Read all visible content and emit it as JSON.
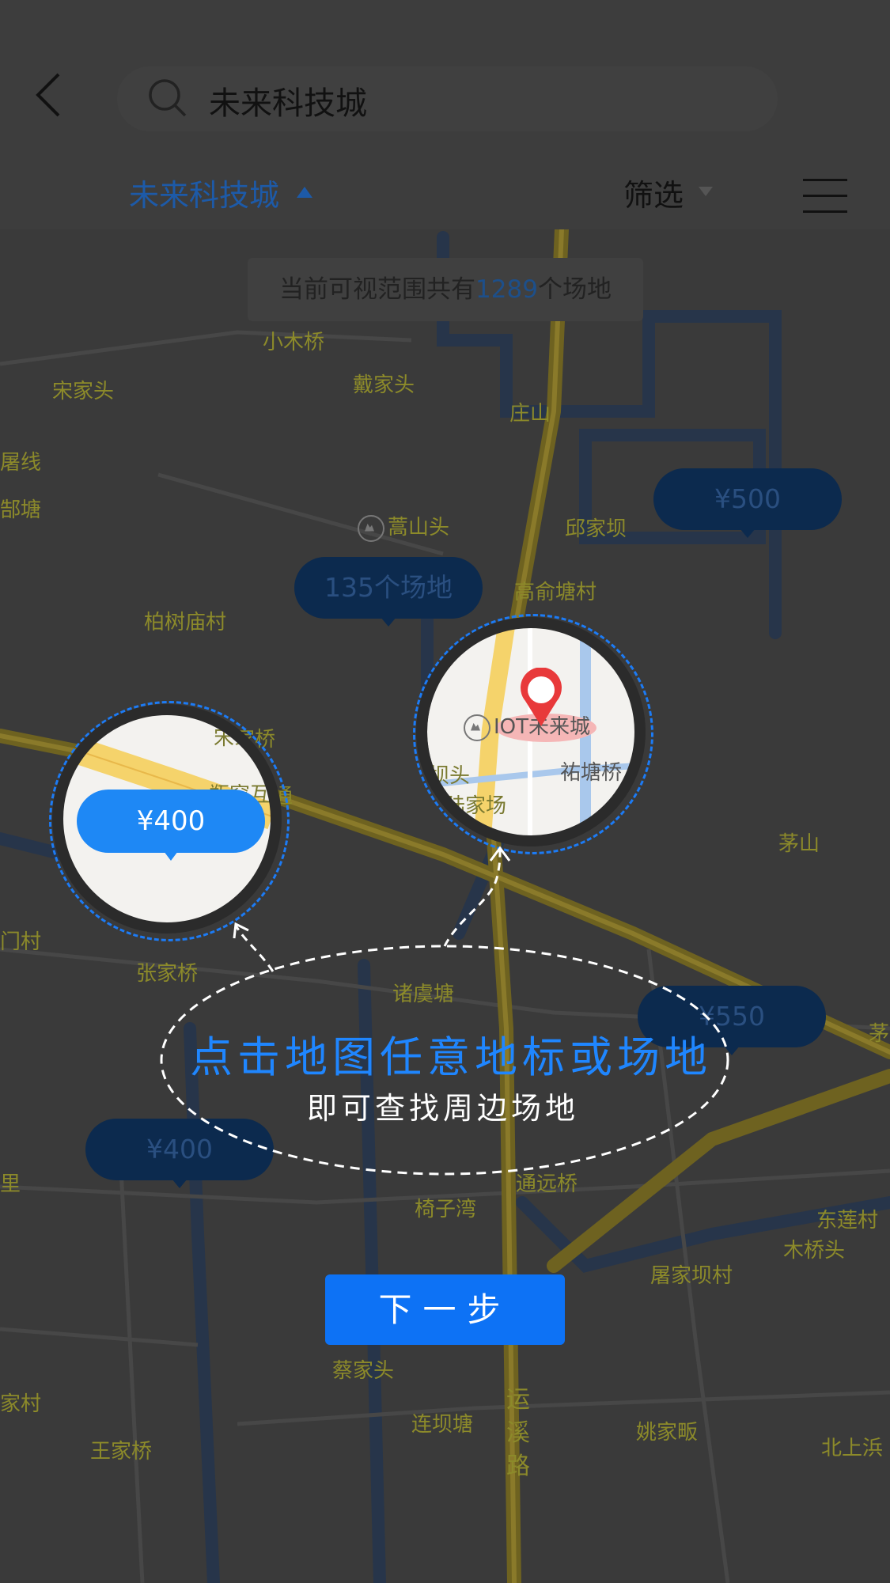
{
  "header": {
    "search_value": "未来科技城",
    "city_tab": "未来科技城",
    "filter_tab": "筛选"
  },
  "banner": {
    "prefix": "当前可视范围共有",
    "count": "1289",
    "suffix": "个场地"
  },
  "map_labels": [
    "小木桥",
    "宋家头",
    "戴家头",
    "庄山",
    "屠线",
    "郜塘",
    "蒿山头",
    "邱家坝",
    "高俞塘村",
    "柏树庙村",
    "吴家桥",
    "孙坝头",
    "陆家场",
    "茅山",
    "门村",
    "张家桥",
    "诸虞塘",
    "茅",
    "里",
    "椅子湾",
    "通远桥",
    "东莲村",
    "木桥头",
    "屠家坝村",
    "蔡家头",
    "连坝塘",
    "运",
    "溪",
    "路",
    "姚家畈",
    "北上浜",
    "家村",
    "王家桥",
    "瓶窑互通",
    "宋家桥",
    "里"
  ],
  "price_tags": {
    "tag_500": "¥500",
    "tag_venues": "135个场地",
    "tag_550": "¥550",
    "tag_400_bottom": "¥400"
  },
  "lens_left": {
    "price": "¥400",
    "labels": [
      "宋家桥",
      "瓶窑互通"
    ]
  },
  "lens_right": {
    "poi": "IOT未来城",
    "labels": [
      "孙坝头",
      "陆家场",
      "祐塘桥"
    ]
  },
  "hint": {
    "title": "点击地图任意地标或场地",
    "subtitle": "即可查找周边场地"
  },
  "next_button": "下一步",
  "colors": {
    "accent": "#1e88f5",
    "overlay_dim": "#3a3a3a",
    "road_yellow": "#8a7a2a"
  }
}
